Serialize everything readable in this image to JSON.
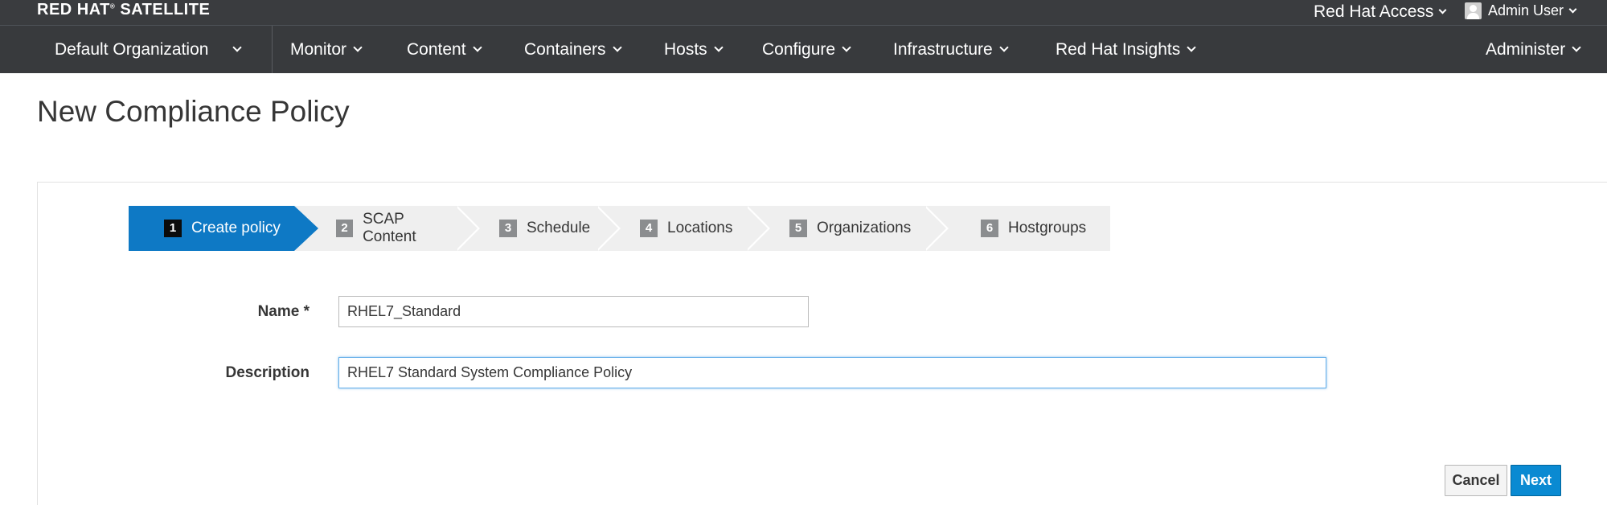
{
  "brand": {
    "name": "RED HAT",
    "trademark": "®",
    "product": "SATELLITE"
  },
  "topbar": {
    "access_label": "Red Hat Access",
    "user_label": "Admin User"
  },
  "nav": {
    "org": "Default Organization",
    "items": [
      "Monitor",
      "Content",
      "Containers",
      "Hosts",
      "Configure",
      "Infrastructure",
      "Red Hat Insights"
    ],
    "admin": "Administer"
  },
  "page": {
    "title": "New Compliance Policy"
  },
  "wizard": {
    "steps": [
      {
        "num": "1",
        "label": "Create policy",
        "active": true
      },
      {
        "num": "2",
        "label": "SCAP Content",
        "active": false
      },
      {
        "num": "3",
        "label": "Schedule",
        "active": false
      },
      {
        "num": "4",
        "label": "Locations",
        "active": false
      },
      {
        "num": "5",
        "label": "Organizations",
        "active": false
      },
      {
        "num": "6",
        "label": "Hostgroups",
        "active": false
      }
    ]
  },
  "form": {
    "name_label": "Name *",
    "name_value": "RHEL7_Standard",
    "description_label": "Description",
    "description_value": "RHEL7 Standard System Compliance Policy"
  },
  "buttons": {
    "cancel": "Cancel",
    "next": "Next"
  },
  "colors": {
    "nav_bg": "#383a3d",
    "active_step": "#0e79c5",
    "primary_button": "#0a8ad2"
  }
}
